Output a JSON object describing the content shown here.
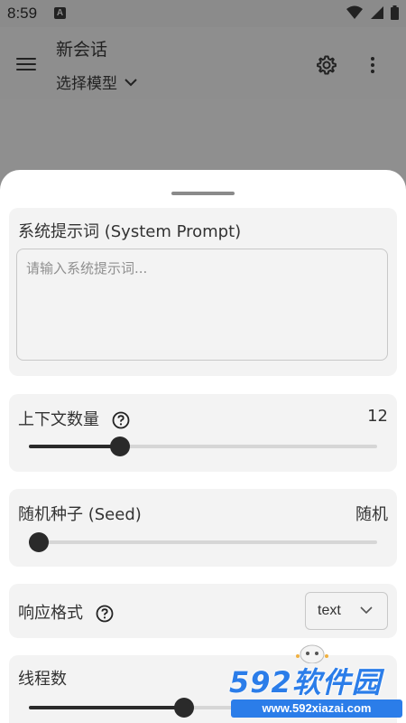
{
  "status_bar": {
    "time": "8:59",
    "notification_letter": "A"
  },
  "app_bar": {
    "title": "新会话",
    "model_select": "选择模型"
  },
  "sheet": {
    "system_prompt": {
      "label": "系统提示词 (System Prompt)",
      "value": "",
      "placeholder": "请输入系统提示词..."
    },
    "context_count": {
      "label": "上下文数量",
      "value_text": "12",
      "fraction": 0.24
    },
    "seed": {
      "label": "随机种子 (Seed)",
      "value_text": "随机",
      "fraction": 0.0
    },
    "response_format": {
      "label": "响应格式",
      "selected": "text"
    },
    "threads": {
      "label": "线程数",
      "fraction": 0.43
    }
  },
  "watermark": {
    "brand": "592软件园",
    "url": "www.592xiazai.com"
  },
  "icons": [
    "menu-icon",
    "chevron-down-icon",
    "gear-icon",
    "more-vert-icon",
    "help-circle-icon",
    "wifi-icon",
    "signal-icon",
    "battery-icon"
  ],
  "colors": {
    "accent": "#2a2a2a",
    "sheet_bg": "#ffffff",
    "card_bg": "#f3f3f3",
    "scrim": "#8f8f8f",
    "watermark": "#2b7de9"
  }
}
